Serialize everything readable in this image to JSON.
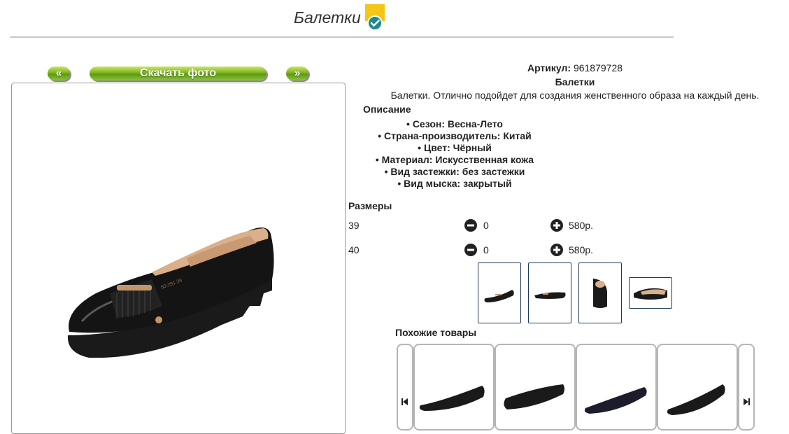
{
  "header": {
    "title": "Балетки",
    "badge_icon": "check-badge-icon",
    "badge_color": "#f5c518",
    "check_color": "#1e8a8a"
  },
  "photo_nav": {
    "prev_label": "«",
    "download_label": "Скачать фото",
    "next_label": "»"
  },
  "product": {
    "article_label": "Артикул:",
    "article_value": "961879728",
    "name": "Балетки",
    "description": "Балетки. Отлично подойдет для создания женственного образа на каждый день.",
    "description_heading": "Описание",
    "features": [
      "• Сезон: Весна-Лето",
      "• Страна-производитель: Китай",
      "• Цвет: Чёрный",
      "• Материал: Искусственная кожа",
      "• Вид застежки: без застежки",
      "• Вид мыска: закрытый"
    ]
  },
  "sizes": {
    "heading": "Размеры",
    "rows": [
      {
        "size": "39",
        "qty": "0",
        "price": "580р."
      },
      {
        "size": "40",
        "qty": "0",
        "price": "580р."
      }
    ]
  },
  "similar": {
    "heading": "Похожие товары"
  }
}
